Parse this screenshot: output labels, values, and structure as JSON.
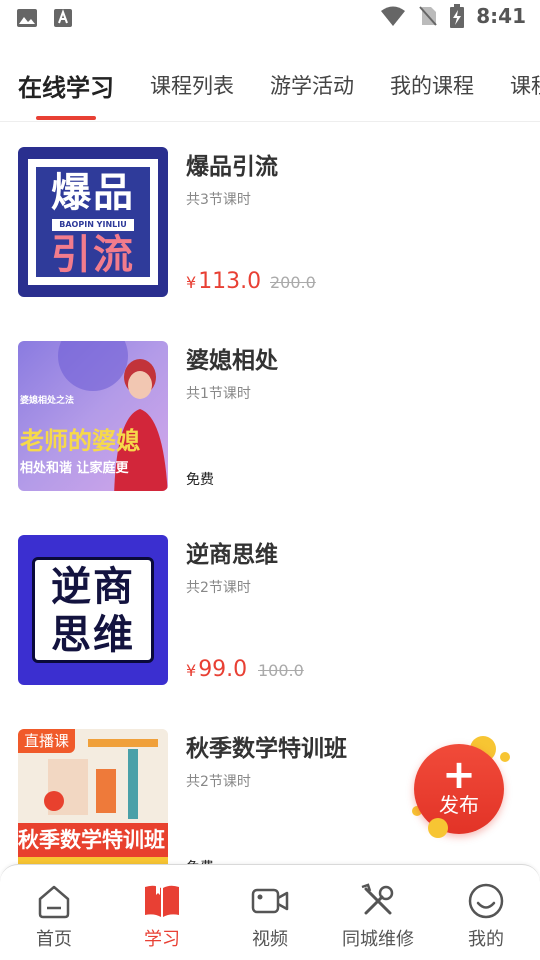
{
  "status_bar": {
    "time": "8:41",
    "left_icons": [
      "image-icon",
      "font-icon"
    ],
    "right_icons": [
      "wifi-icon",
      "no-sim-icon",
      "battery-charging-icon"
    ]
  },
  "tabs": [
    {
      "label": "在线学习",
      "active": true
    },
    {
      "label": "课程列表",
      "active": false
    },
    {
      "label": "游学活动",
      "active": false
    },
    {
      "label": "我的课程",
      "active": false
    },
    {
      "label": "课程",
      "active": false
    }
  ],
  "courses": [
    {
      "title": "爆品引流",
      "lessons": "共3节课时",
      "price_symbol": "¥",
      "price": "113.0",
      "original_price": "200.0",
      "thumb": {
        "line1": "爆品",
        "line2": "引流",
        "sub": "BAOPIN YINLIU"
      }
    },
    {
      "title": "婆媳相处",
      "lessons": "共1节课时",
      "free_label": "免费",
      "thumb": {
        "line1": "婆媳相处之法",
        "line2": "老师的婆媳",
        "line3": "相处和谐 让家庭更"
      }
    },
    {
      "title": "逆商思维",
      "lessons": "共2节课时",
      "price_symbol": "¥",
      "price": "99.0",
      "original_price": "100.0",
      "thumb": {
        "line1": "逆商",
        "line2": "思维"
      }
    },
    {
      "title": "秋季数学特训班",
      "lessons": "共2节课时",
      "free_label": "免费",
      "thumb": {
        "badge": "直播课",
        "banner": "秋季数学特训班"
      }
    }
  ],
  "fab": {
    "plus": "+",
    "label": "发布"
  },
  "bottom_nav": [
    {
      "label": "首页",
      "icon": "home-icon",
      "active": false
    },
    {
      "label": "学习",
      "icon": "book-icon",
      "active": true
    },
    {
      "label": "视频",
      "icon": "video-camera-icon",
      "active": false
    },
    {
      "label": "同城维修",
      "icon": "tools-icon",
      "active": false
    },
    {
      "label": "我的",
      "icon": "smile-icon",
      "active": false
    }
  ],
  "colors": {
    "accent": "#e84034",
    "text": "#333333",
    "muted": "#888888"
  }
}
